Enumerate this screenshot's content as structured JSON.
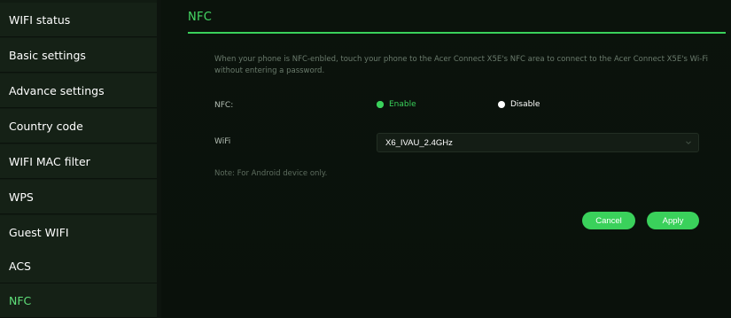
{
  "sidebar": {
    "items": [
      {
        "label": "WIFI status"
      },
      {
        "label": "Basic settings"
      },
      {
        "label": "Advance settings"
      },
      {
        "label": "Country code"
      },
      {
        "label": "WIFI MAC filter"
      },
      {
        "label": "WPS"
      },
      {
        "label": "Guest WIFI"
      },
      {
        "label": "ACS"
      },
      {
        "label": "NFC",
        "active": true
      }
    ]
  },
  "main": {
    "title": "NFC",
    "description": "When your phone is NFC-enbled, touch your phone to the Acer Connect X5E's NFC area to connect to the Acer Connect X5E's Wi-Fi without entering a password.",
    "nfc": {
      "label": "NFC:",
      "options": [
        "Enable",
        "Disable"
      ],
      "selected": "Enable"
    },
    "wifi": {
      "label": "WiFi",
      "selected": "X6_IVAU_2.4GHz"
    },
    "note": "Note: For Android device only.",
    "buttons": {
      "cancel": "Cancel",
      "apply": "Apply"
    }
  },
  "colors": {
    "accent": "#3ad15b",
    "background": "#0d140e",
    "sidebar_item": "#152116"
  },
  "icons": {
    "wifi_select": "chevron-down-icon"
  }
}
